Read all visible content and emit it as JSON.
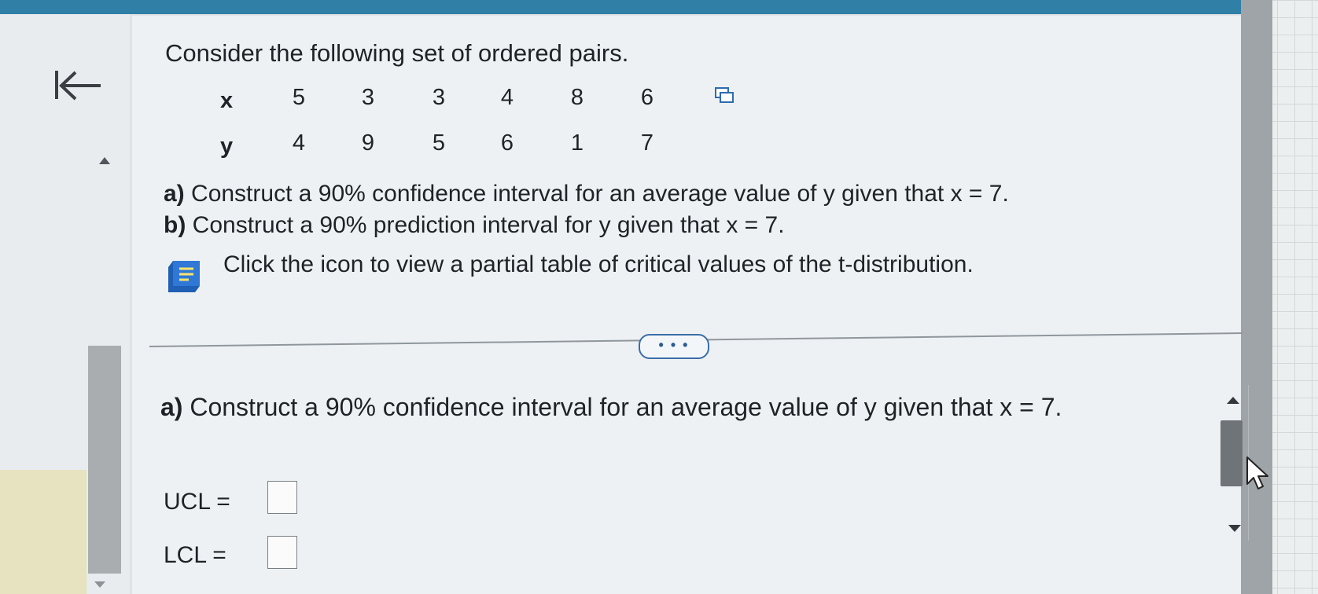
{
  "problem": {
    "title": "Consider the following set of ordered pairs.",
    "x_label": "x",
    "y_label": "y",
    "x_values": [
      "5",
      "3",
      "3",
      "4",
      "8",
      "6"
    ],
    "y_values": [
      "4",
      "9",
      "5",
      "6",
      "1",
      "7"
    ],
    "part_a_prefix": "a)",
    "part_a_text": " Construct a 90% confidence interval for an average value of y given that x = 7.",
    "part_b_prefix": "b)",
    "part_b_text": " Construct a 90% prediction interval for y given that x = 7.",
    "help_text": "Click the icon to view a partial table of critical values of the t-distribution."
  },
  "divider": {
    "more_label": "• • •"
  },
  "answer": {
    "part_prefix": "a)",
    "part_text": " Construct a 90% confidence interval for an average value of y given that x = 7.",
    "ucl_label": "UCL =",
    "lcl_label": "LCL =",
    "ucl_value": "",
    "lcl_value": ""
  },
  "colors": {
    "accent": "#2f7fa6",
    "link": "#3a6ea8"
  }
}
